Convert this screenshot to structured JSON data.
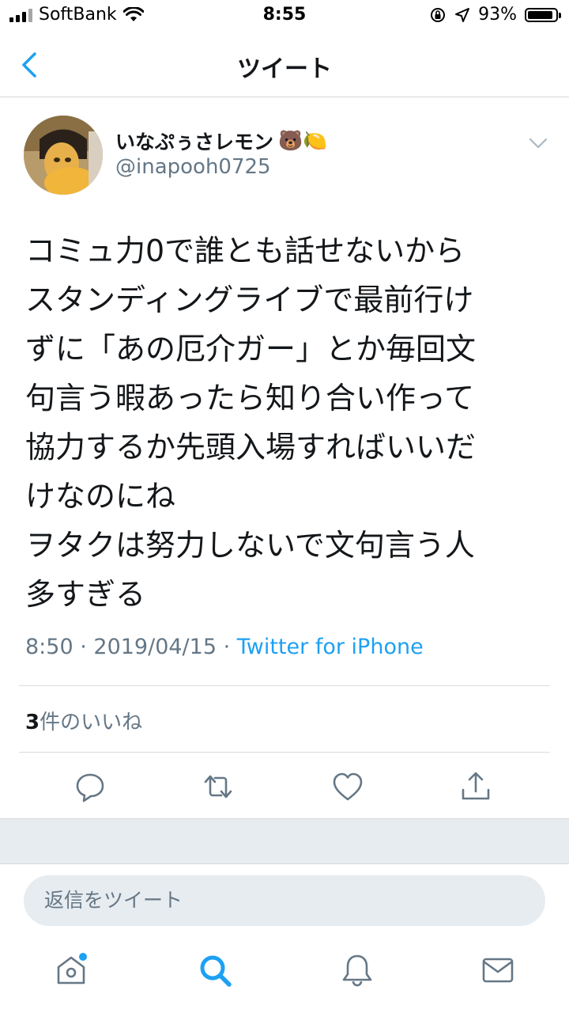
{
  "status_bar": {
    "carrier": "SoftBank",
    "time": "8:55",
    "battery": "93%"
  },
  "nav": {
    "title": "ツイート"
  },
  "tweet": {
    "display_name": "いなぷぅさレモン",
    "name_emoji": "🐻🍋",
    "handle": "@inapooh0725",
    "text": "コミュ力0で誰とも話せないから\nスタンディングライブで最前行け\nずに「あの厄介ガー」とか毎回文\n句言う暇あったら知り合い作って\n協力するか先頭入場すればいいだ\nけなのにね\nヲタクは努力しないで文句言う人\n多すぎる",
    "time": "8:50",
    "date": "2019/04/15",
    "separator": " · ",
    "source": "Twitter for iPhone",
    "like_count": "3",
    "like_label": "件のいいね"
  },
  "reply": {
    "placeholder": "返信をツイート"
  },
  "colors": {
    "accent": "#1da1f2",
    "secondary_text": "#657786",
    "icon_gray": "#657786"
  }
}
